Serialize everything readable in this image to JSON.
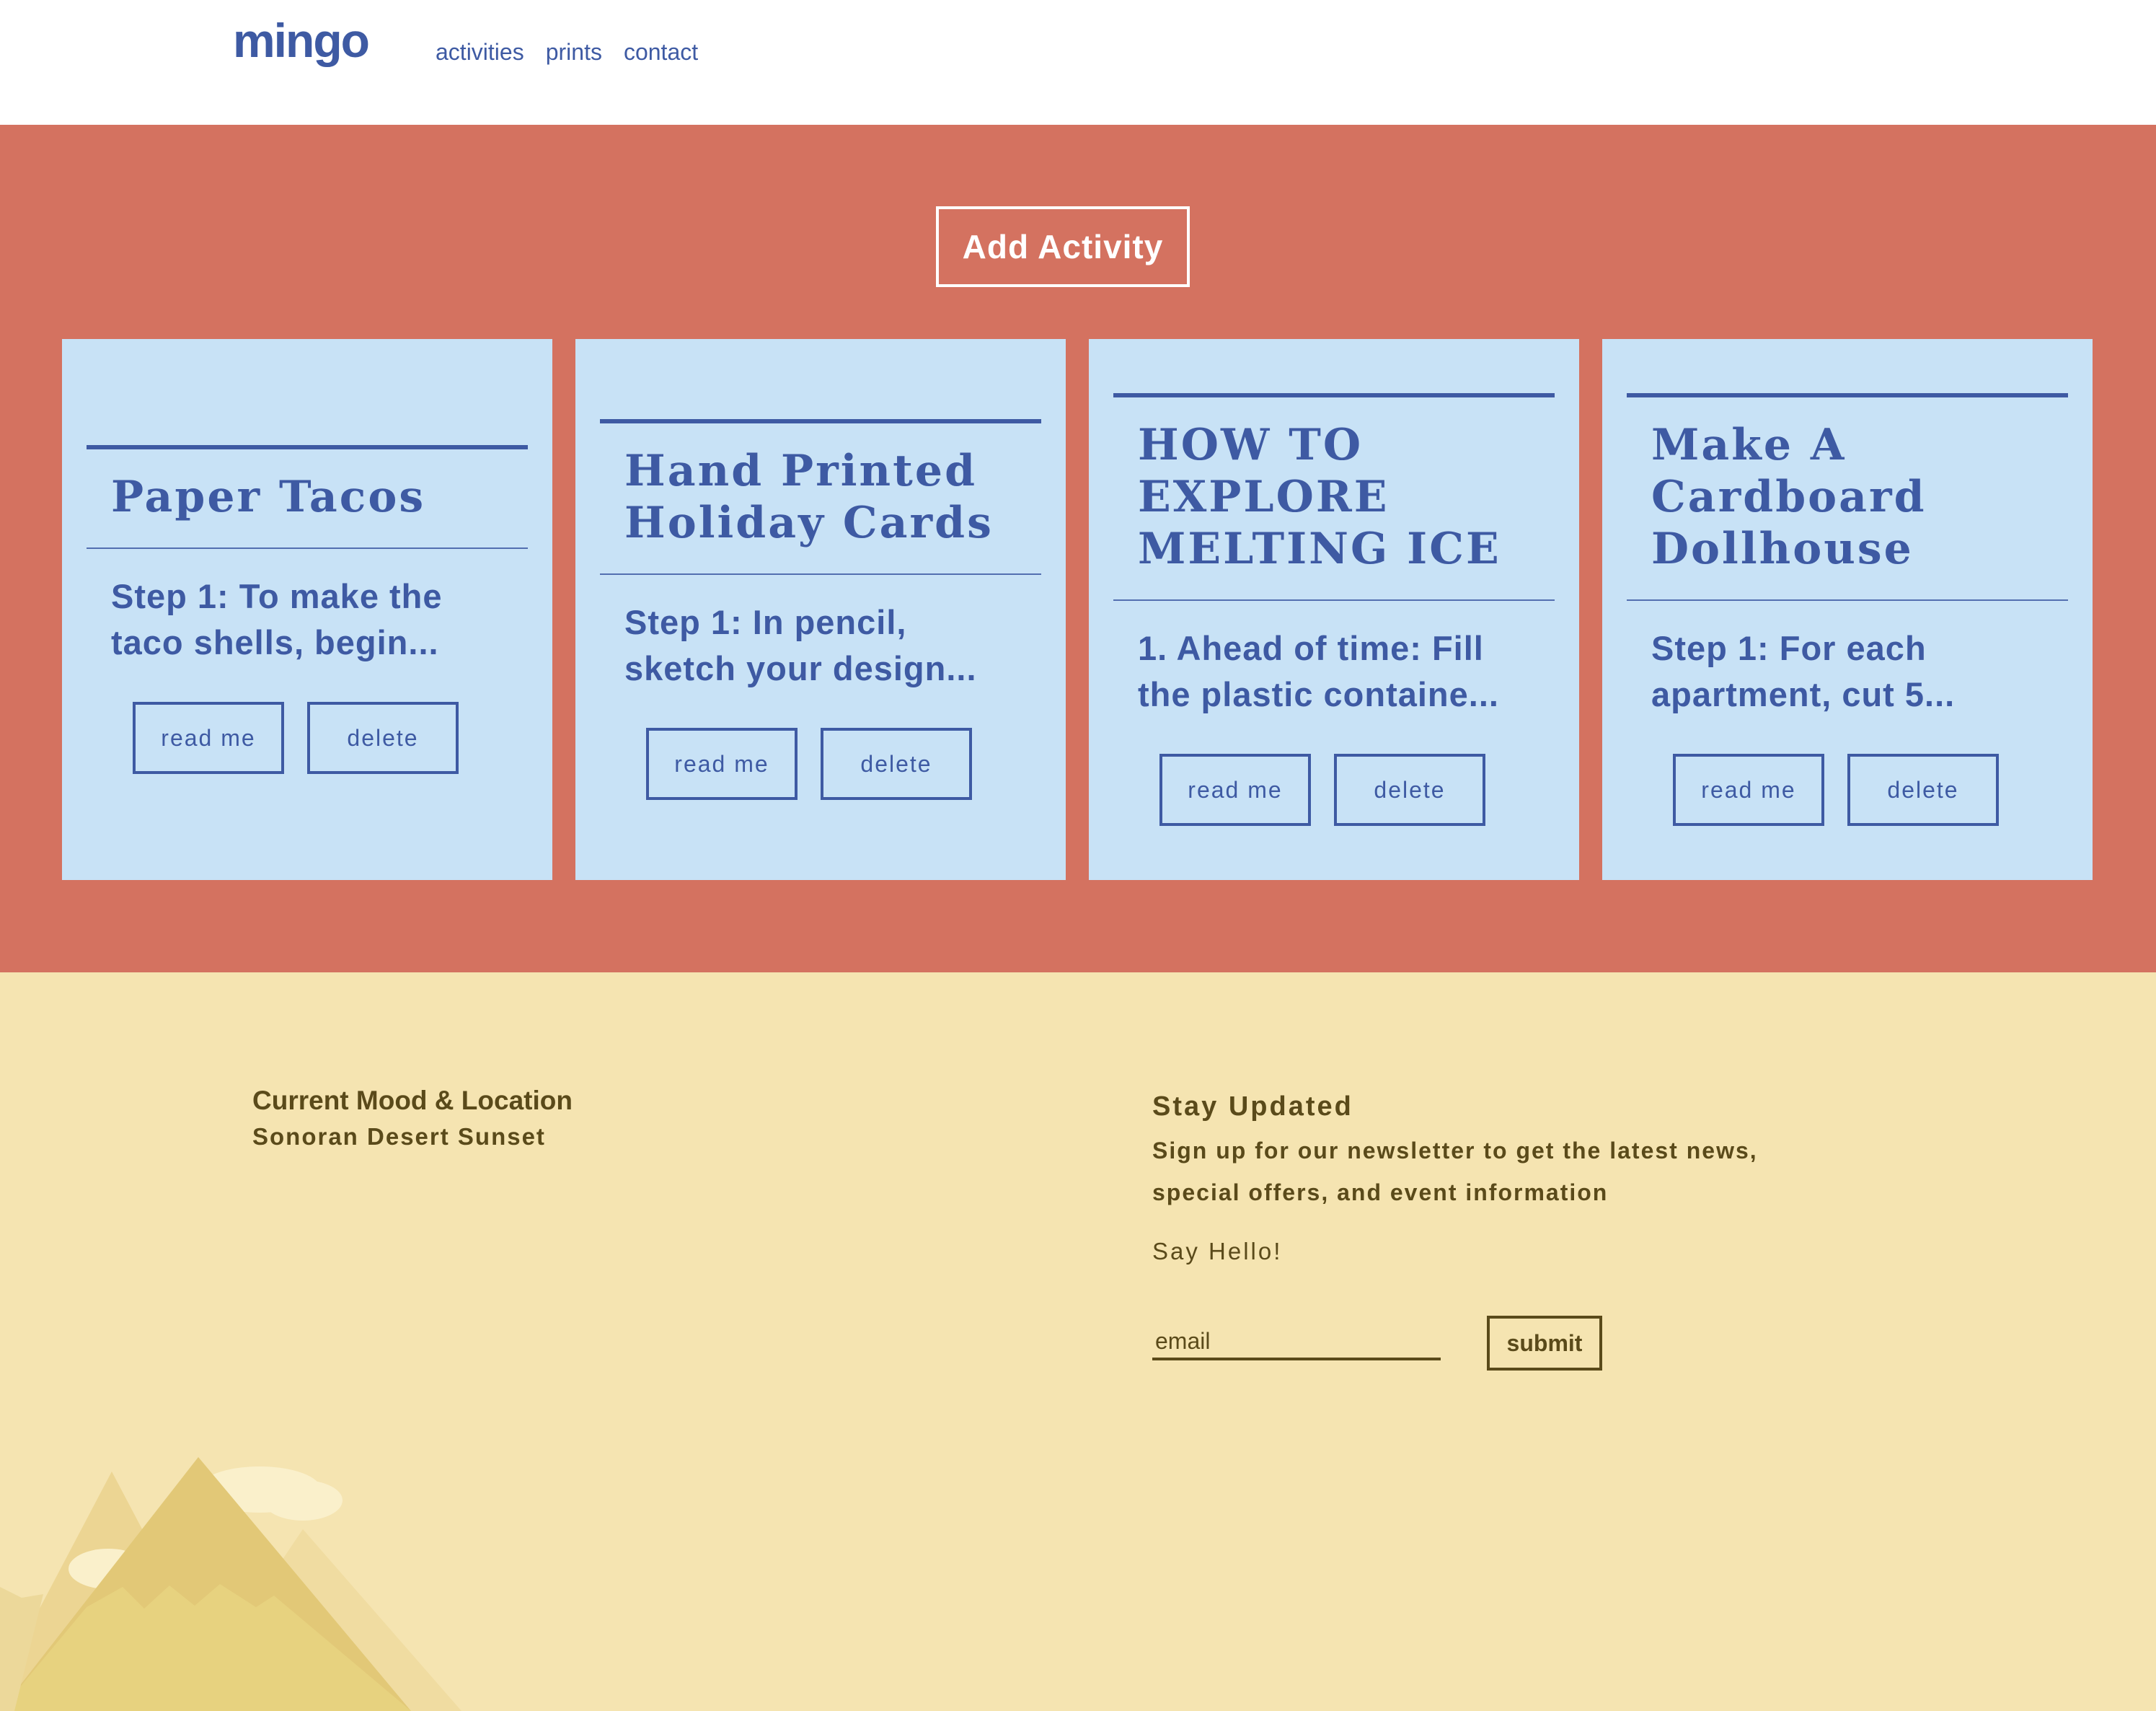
{
  "header": {
    "logo": "mingo",
    "nav": [
      "activities",
      "prints",
      "contact"
    ]
  },
  "activities": {
    "add_label": "Add Activity",
    "read_label": "read me",
    "delete_label": "delete",
    "cards": [
      {
        "title": "Paper Tacos",
        "excerpt": "Step 1: To make the taco shells, begin..."
      },
      {
        "title": "Hand Printed Holiday Cards",
        "excerpt": "Step 1: In pencil, sketch your design..."
      },
      {
        "title": "HOW TO EXPLORE MELTING ICE",
        "excerpt": "1. Ahead of time: Fill the plastic containe..."
      },
      {
        "title": "Make A Cardboard Dollhouse",
        "excerpt": "Step 1: For each apartment, cut 5..."
      }
    ]
  },
  "footer": {
    "mood_title": "Current Mood & Location",
    "mood_value": "Sonoran Desert Sunset",
    "newsletter_title": "Stay Updated",
    "newsletter_desc": "Sign up for our newsletter to get the latest news, special offers, and event information",
    "say_hello": "Say Hello!",
    "email_placeholder": "email",
    "submit_label": "submit"
  },
  "colors": {
    "brand_blue": "#3e5aa3",
    "band_coral": "#d47260",
    "card_blue": "#c8e2f6",
    "footer_sand": "#f5e4b1",
    "footer_text": "#5a4a1a"
  }
}
